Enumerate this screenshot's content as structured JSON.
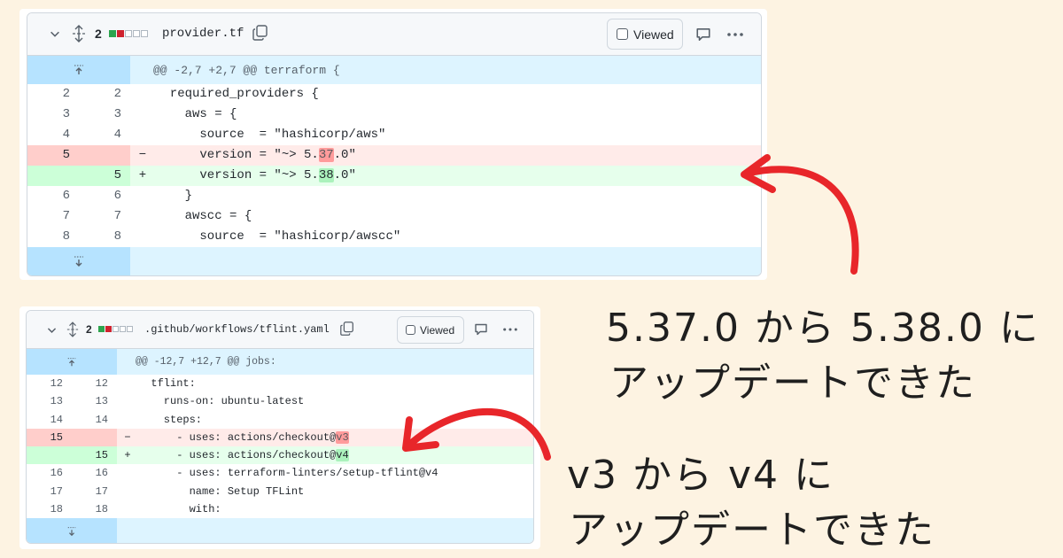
{
  "panel1": {
    "diff_count": "2",
    "file_name": "provider.tf",
    "viewed_label": "Viewed",
    "hunk_header": "@@ -2,7 +2,7 @@ terraform {",
    "lines": [
      {
        "type": "ctx",
        "old": "2",
        "new": "2",
        "sign": "",
        "code": "  required_providers {"
      },
      {
        "type": "ctx",
        "old": "3",
        "new": "3",
        "sign": "",
        "code": "    aws = {"
      },
      {
        "type": "ctx",
        "old": "4",
        "new": "4",
        "sign": "",
        "code": "      source  = \"hashicorp/aws\""
      },
      {
        "type": "del",
        "old": "5",
        "new": "",
        "sign": "−",
        "code_pre": "      version = \"~> 5.",
        "code_hl": "37",
        "code_post": ".0\""
      },
      {
        "type": "add",
        "old": "",
        "new": "5",
        "sign": "+",
        "code_pre": "      version = \"~> 5.",
        "code_hl": "38",
        "code_post": ".0\""
      },
      {
        "type": "ctx",
        "old": "6",
        "new": "6",
        "sign": "",
        "code": "    }"
      },
      {
        "type": "ctx",
        "old": "7",
        "new": "7",
        "sign": "",
        "code": "    awscc = {"
      },
      {
        "type": "ctx",
        "old": "8",
        "new": "8",
        "sign": "",
        "code": "      source  = \"hashicorp/awscc\""
      }
    ]
  },
  "panel2": {
    "diff_count": "2",
    "file_name": ".github/workflows/tflint.yaml",
    "viewed_label": "Viewed",
    "hunk_header": "@@ -12,7 +12,7 @@ jobs:",
    "lines": [
      {
        "type": "ctx",
        "old": "12",
        "new": "12",
        "sign": "",
        "code": "  tflint:"
      },
      {
        "type": "ctx",
        "old": "13",
        "new": "13",
        "sign": "",
        "code": "    runs-on: ubuntu-latest"
      },
      {
        "type": "ctx",
        "old": "14",
        "new": "14",
        "sign": "",
        "code": "    steps:"
      },
      {
        "type": "del",
        "old": "15",
        "new": "",
        "sign": "−",
        "code_pre": "      - uses: actions/checkout@",
        "code_hl": "v3",
        "code_post": ""
      },
      {
        "type": "add",
        "old": "",
        "new": "15",
        "sign": "+",
        "code_pre": "      - uses: actions/checkout@",
        "code_hl": "v4",
        "code_post": ""
      },
      {
        "type": "ctx",
        "old": "16",
        "new": "16",
        "sign": "",
        "code": "      - uses: terraform-linters/setup-tflint@v4"
      },
      {
        "type": "ctx",
        "old": "17",
        "new": "17",
        "sign": "",
        "code": "        name: Setup TFLint"
      },
      {
        "type": "ctx",
        "old": "18",
        "new": "18",
        "sign": "",
        "code": "        with:"
      }
    ]
  },
  "annotation1": {
    "line1": "5.37.0 から 5.38.0 に",
    "line2": "アップデートできた"
  },
  "annotation2": {
    "line1": "v3 から v4 に",
    "line2": "アップデートできた"
  },
  "colors": {
    "background": "#fdf3e2",
    "arrow": "#e8262a",
    "added": "#2da44e",
    "deleted": "#cf222e",
    "hunk": "#ddf4ff"
  },
  "icons": [
    "chevron-down-icon",
    "expand-vertical-icon",
    "copy-icon",
    "checkbox-icon",
    "comment-icon",
    "kebab-icon",
    "expand-up-icon",
    "expand-down-icon"
  ]
}
